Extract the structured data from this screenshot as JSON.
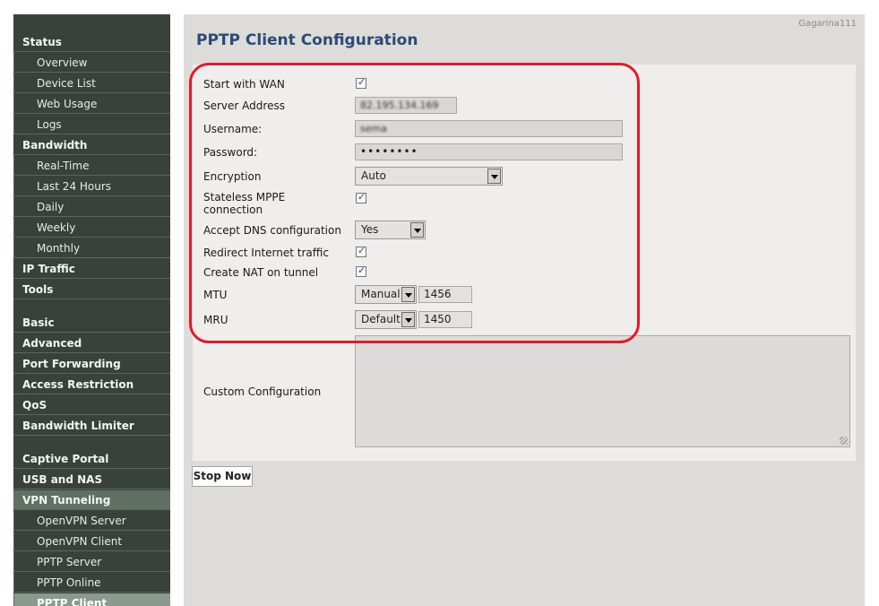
{
  "router_name": "Gagarina111",
  "page_title": "PPTP Client Configuration",
  "sidebar": {
    "status": "Status",
    "overview": "Overview",
    "device_list": "Device List",
    "web_usage": "Web Usage",
    "logs": "Logs",
    "bandwidth": "Bandwidth",
    "real_time": "Real-Time",
    "last_24_hours": "Last 24 Hours",
    "daily": "Daily",
    "weekly": "Weekly",
    "monthly": "Monthly",
    "ip_traffic": "IP Traffic",
    "tools": "Tools",
    "basic": "Basic",
    "advanced": "Advanced",
    "port_forwarding": "Port Forwarding",
    "access_restriction": "Access Restriction",
    "qos": "QoS",
    "bandwidth_limiter": "Bandwidth Limiter",
    "captive_portal": "Captive Portal",
    "usb_and_nas": "USB and NAS",
    "vpn_tunneling": "VPN Tunneling",
    "openvpn_server": "OpenVPN Server",
    "openvpn_client": "OpenVPN Client",
    "pptp_server": "PPTP Server",
    "pptp_online": "PPTP Online",
    "pptp_client": "PPTP Client"
  },
  "form": {
    "start_with_wan_label": "Start with WAN",
    "start_with_wan_checked": true,
    "server_address_label": "Server Address",
    "server_address_value": "82.195.134.169",
    "username_label": "Username:",
    "username_value": "sema",
    "password_label": "Password:",
    "password_value": "••••••••",
    "encryption_label": "Encryption",
    "encryption_value": "Auto",
    "stateless_mppe_label_1": "Stateless MPPE",
    "stateless_mppe_label_2": "connection",
    "stateless_mppe_checked": true,
    "accept_dns_label": "Accept DNS configuration",
    "accept_dns_value": "Yes",
    "redirect_internet_label": "Redirect Internet traffic",
    "redirect_internet_checked": true,
    "create_nat_label": "Create NAT on tunnel",
    "create_nat_checked": true,
    "mtu_label": "MTU",
    "mtu_mode": "Manual",
    "mtu_value": "1456",
    "mru_label": "MRU",
    "mru_mode": "Default",
    "mru_value": "1450",
    "custom_config_label": "Custom Configuration",
    "custom_config_value": ""
  },
  "buttons": {
    "stop_now": "Stop Now"
  },
  "colors": {
    "sidebar_bg": "#39413b",
    "title_color": "#2b4a78",
    "highlight_color": "#e4192a"
  }
}
